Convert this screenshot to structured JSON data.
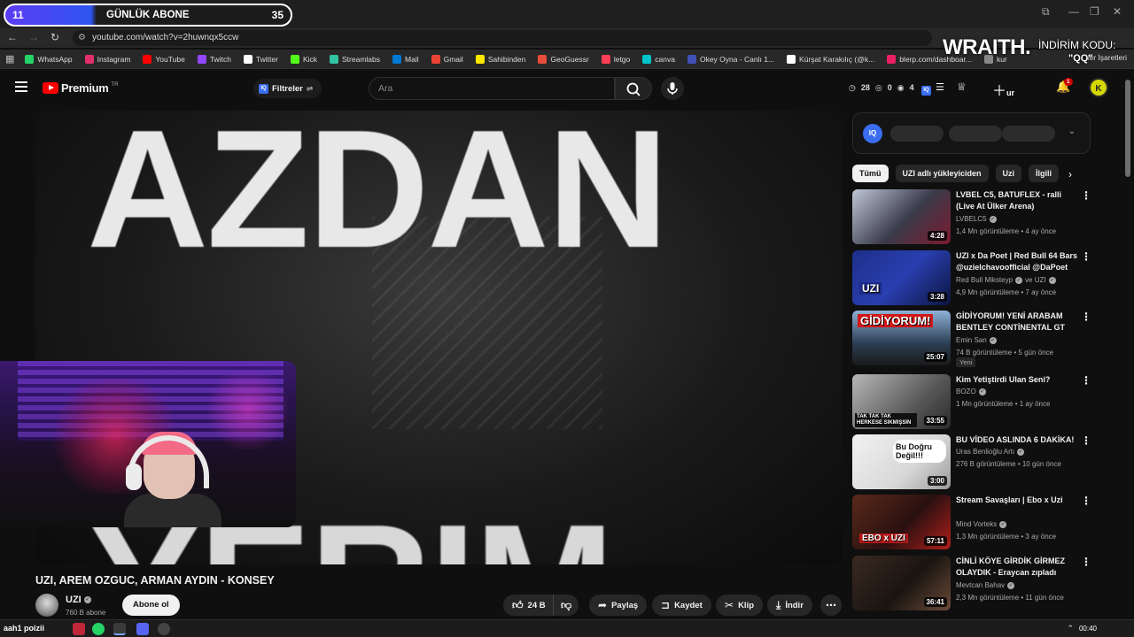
{
  "overlay": {
    "sub_left": "11",
    "sub_label": "GÜNLÜK ABONE",
    "sub_right": "35",
    "sponsor_brand": "WRAITH.",
    "sponsor_code_label": "İNDİRİM KODU:",
    "sponsor_code": "\"QQ\""
  },
  "browser": {
    "url": "youtube.com/watch?v=2huwnqx5ccw",
    "bookmarks": [
      {
        "label": "WhatsApp",
        "color": "#25d366"
      },
      {
        "label": "Instagram",
        "color": "#e1306c"
      },
      {
        "label": "YouTube",
        "color": "#ff0000"
      },
      {
        "label": "Twitch",
        "color": "#9146ff"
      },
      {
        "label": "Twitter",
        "color": "#ffffff"
      },
      {
        "label": "Kick",
        "color": "#53fc18"
      },
      {
        "label": "Streamlabs",
        "color": "#31c3a2"
      },
      {
        "label": "Mail",
        "color": "#0078d4"
      },
      {
        "label": "Gmail",
        "color": "#ea4335"
      },
      {
        "label": "Sahibinden",
        "color": "#ffe800"
      },
      {
        "label": "GeoGuessr",
        "color": "#e74c3c"
      },
      {
        "label": "letgo",
        "color": "#ff3f55"
      },
      {
        "label": "canva",
        "color": "#00c4cc"
      },
      {
        "label": "Okey Oyna - Canlı 1...",
        "color": "#3f51b5"
      },
      {
        "label": "Kürşat Karakılıç (@k...",
        "color": "#ffffff"
      },
      {
        "label": "blerp.com/dashboar...",
        "color": "#e91e63"
      },
      {
        "label": "kur",
        "color": "#888888"
      }
    ],
    "other_bookmarks": "ler İşaretleri"
  },
  "header": {
    "logo": "Premium",
    "logo_region": "TR",
    "filters_label": "Filtreler",
    "search_placeholder": "Ara",
    "stat_1": "28",
    "stat_2": "0",
    "stat_3": "4",
    "create_label": "ur",
    "notif_count": "1",
    "avatar_letter": "K"
  },
  "video": {
    "frame_text_top": "AZDAN",
    "frame_text_bottom": "YERIM",
    "title": "UZI, AREM OZGUC, ARMAN AYDIN - KONSEY",
    "channel": "UZI",
    "subs": "760 B abone",
    "subscribe": "Abone ol",
    "likes": "24 B",
    "share": "Paylaş",
    "save": "Kaydet",
    "clip": "Klip",
    "download": "İndir"
  },
  "sidebar": {
    "chips": [
      "Tümü",
      "UZI adlı yükleyiciden",
      "Uzi",
      "İlgili"
    ],
    "recs": [
      {
        "title": "LVBEL C5, BATUFLEX - ralli (Live At Ülker Arena)",
        "channel": "LVBELC5",
        "meta": "1,4 Mn görüntüleme • 4 ay önce",
        "duration": "4:28",
        "bg": "linear-gradient(135deg,#c0c8d8,#3a3a4a 55%,#7b1b2e)"
      },
      {
        "title": "UZI x Da Poet | Red Bull 64 Bars @uzielchavoofficial @DaPoet",
        "channel": "Red Bull Miksteyp",
        "channel_extra": "ve UZI",
        "meta": "4,9 Mn görüntüleme • 7 ay önce",
        "duration": "3:28",
        "bg": "linear-gradient(135deg,#1d2f8a,#2a3fb0 50%,#0c1540)",
        "thumb_text": "UZI"
      },
      {
        "title": "GİDİYORUM! YENİ ARABAM BENTLEY CONTİNENTAL GT",
        "channel": "Emin San",
        "meta": "74 B görüntüleme • 5 gün önce",
        "duration": "25:07",
        "bg": "linear-gradient(180deg,#8fb2d8,#2c3e54 60%,#1a1a1a)",
        "thumb_text": "GİDİYORUM!",
        "badge": "Yeni"
      },
      {
        "title": "Kim Yetiştirdi Ulan Seni?",
        "channel": "BOZO",
        "meta": "1 Mn görüntüleme • 1 ay önce",
        "duration": "33:55",
        "bg": "linear-gradient(135deg,#b7b7b7,#5a5a5a 60%,#2a2a2a)",
        "thumb_text": "TAK TAK TAK HERKESE SIKMIŞSIN"
      },
      {
        "title": "BU VİDEO ASLINDA 6 DAKİKA!",
        "channel": "Uras Benlioğlu Artı",
        "meta": "276 B görüntüleme • 10 gün önce",
        "duration": "3:00",
        "bg": "linear-gradient(135deg,#f2f2f2,#d8d8d8 60%,#9a9a9a)",
        "thumb_text": "Bu Doğru Değil!!!"
      },
      {
        "title": "Stream Savaşları | Ebo x Uzi",
        "channel": "Mind Vorteks",
        "meta": "1,3 Mn görüntüleme • 3 ay önce",
        "duration": "57:11",
        "bg": "linear-gradient(135deg,#5a2a1a,#2a1010 55%,#b0201a)",
        "thumb_text": "EBO x UZI"
      },
      {
        "title": "CİNLİ KÖYE GİRDİK GİRMEZ OLAYDIK - Eraycan zıpladı",
        "channel": "Mevtcan Bahav",
        "meta": "2,3 Mn görüntüleme • 11 gün önce",
        "duration": "36:41",
        "bg": "linear-gradient(135deg,#3a2a22,#1a1410 55%,#6a4a3a)"
      }
    ]
  },
  "taskbar": {
    "label": "aah1 poizii",
    "time": "00:40"
  }
}
